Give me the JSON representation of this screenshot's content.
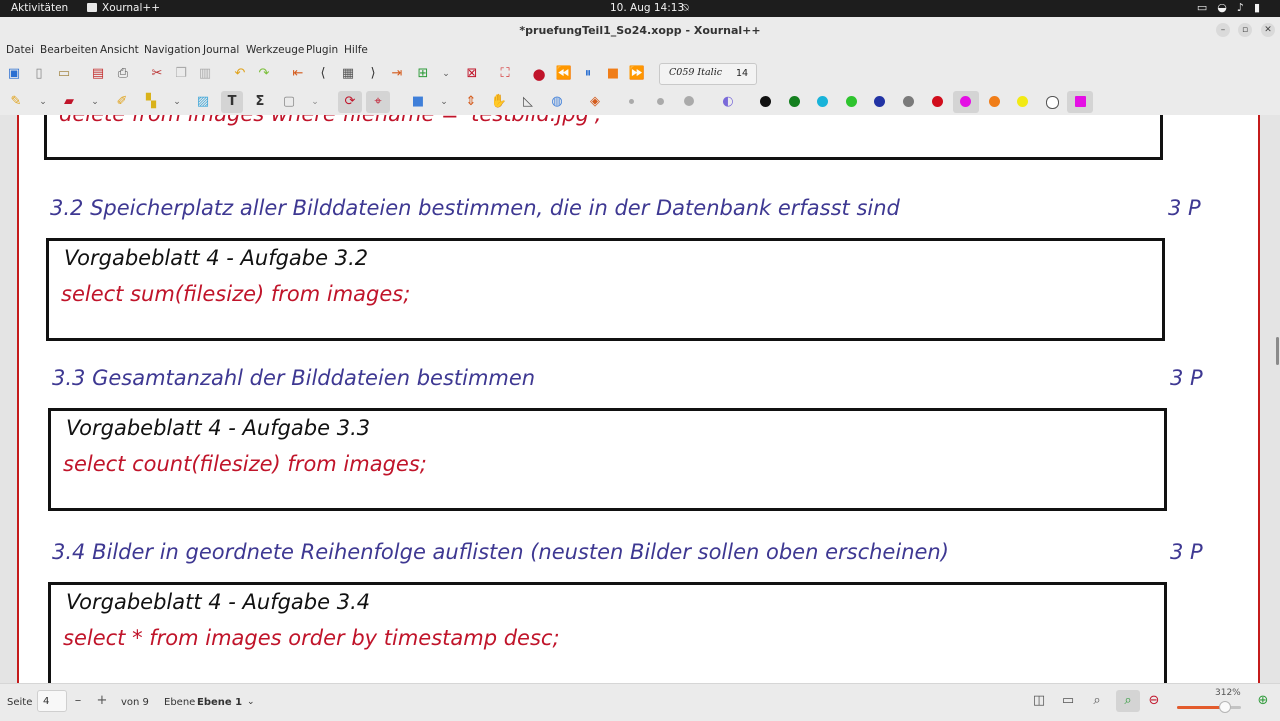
{
  "system_bar": {
    "activities": "Aktivitäten",
    "app_name": "Xournal++",
    "clock": "10. Aug  14:13"
  },
  "window": {
    "title": "*pruefungTeil1_So24.xopp - Xournal++"
  },
  "menu": [
    "Datei",
    "Bearbeiten",
    "Ansicht",
    "Navigation",
    "Journal",
    "Werkzeuge",
    "Plugin",
    "Hilfe"
  ],
  "toolbar": {
    "font_name": "C059 Italic",
    "font_size": "14"
  },
  "pen_colors": [
    "#111111",
    "#14801f",
    "#18b3d9",
    "#2ec42e",
    "#2233a4",
    "#7a7a7a",
    "#d10d1c",
    "#e40fe4",
    "#f07d18",
    "#f2ea14",
    "#ffffff",
    "#e40fe4"
  ],
  "document": {
    "top_partial": "delete  from  images  where  filename = 'testbild.jpg';",
    "sections": [
      {
        "heading": "3.2 Speicherplatz aller Bilddateien bestimmen, die in der Datenbank erfasst sind",
        "points": "3 P",
        "box_title": "Vorgabeblatt 4 - Aufgabe 3.2",
        "answer": "select  sum(filesize)  from  images;"
      },
      {
        "heading": "3.3 Gesamtanzahl der Bilddateien bestimmen",
        "points": "3 P",
        "box_title": "Vorgabeblatt 4 - Aufgabe 3.3",
        "answer": "select  count(filesize)  from  images;"
      },
      {
        "heading": "3.4 Bilder in geordnete Reihenfolge auflisten (neusten Bilder sollen oben erscheinen)",
        "points": "3 P",
        "box_title": "Vorgabeblatt 4 - Aufgabe 3.4",
        "answer": "select  *  from  images  order by  timestamp  desc;"
      }
    ]
  },
  "statusbar": {
    "page_label": "Seite",
    "page_value": "4",
    "of_label": "von 9",
    "layer_label": "Ebene",
    "layer_value": "Ebene 1",
    "zoom_text": "312%",
    "zoom_level": 0.75
  }
}
